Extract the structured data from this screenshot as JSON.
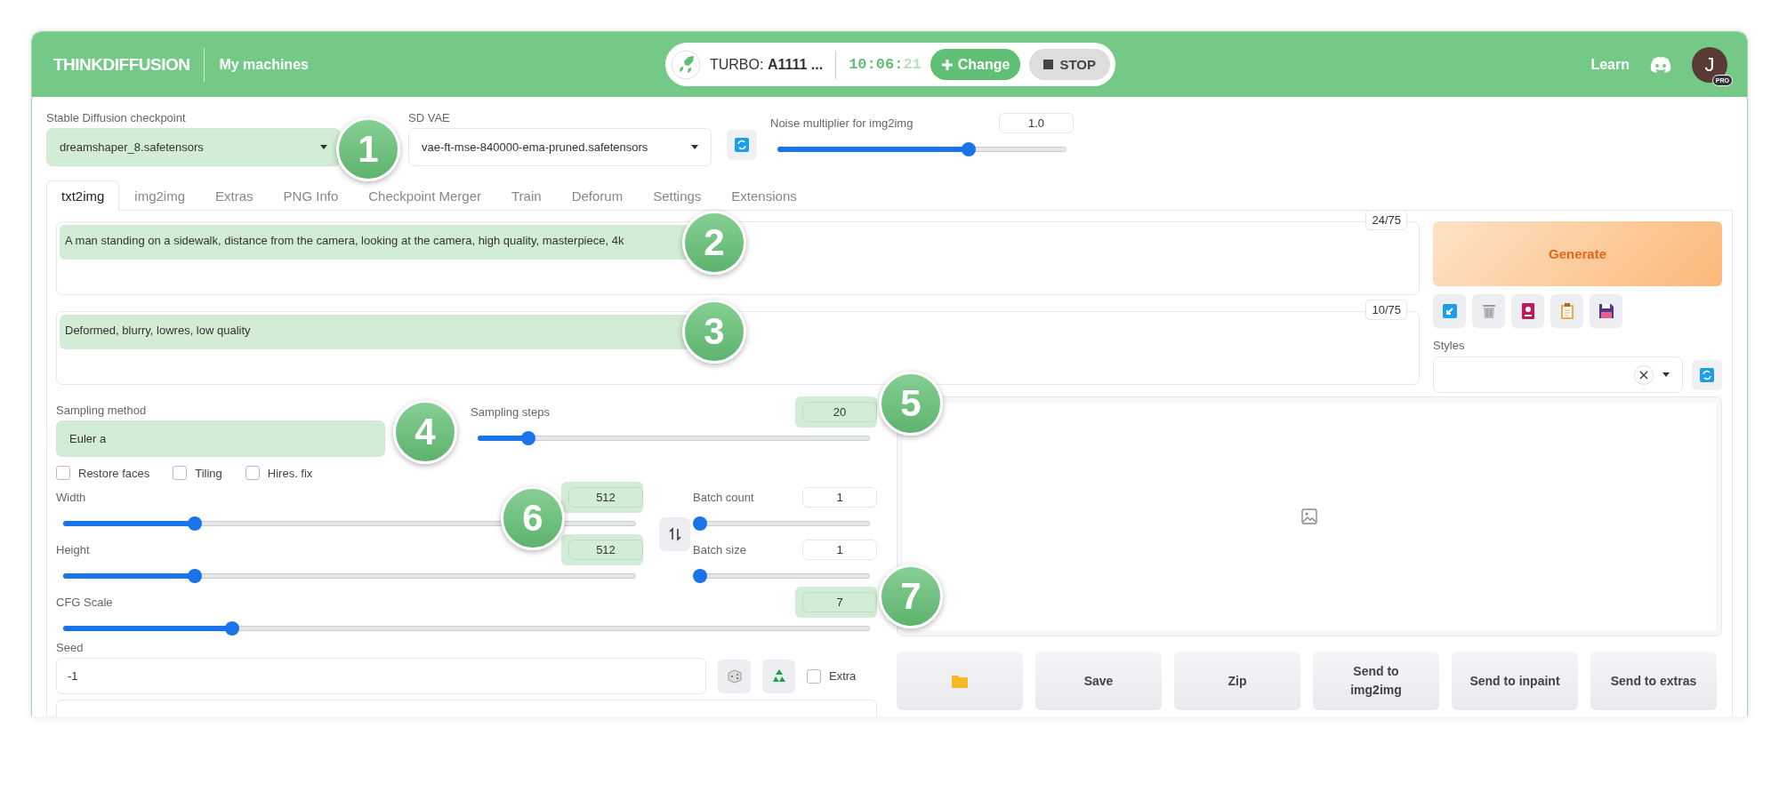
{
  "header": {
    "logo": "THINKDIFFUSION",
    "nav_link": "My machines",
    "machine_label": "TURBO:",
    "machine_name": "A1111 ...",
    "time_main": "10:06:",
    "time_seconds": "21",
    "change_button": "Change",
    "stop_button": "STOP",
    "learn_link": "Learn",
    "avatar_initial": "J",
    "avatar_badge": "PRO"
  },
  "checkpoint": {
    "label": "Stable Diffusion checkpoint",
    "value": "dreamshaper_8.safetensors",
    "highlighted": true
  },
  "vae": {
    "label": "SD VAE",
    "value": "vae-ft-mse-840000-ema-pruned.safetensors",
    "highlighted": false
  },
  "noise": {
    "label": "Noise multiplier for img2img",
    "value": "1.0",
    "level": 0.66,
    "highlighted": false
  },
  "tabs": [
    {
      "label": "txt2img",
      "selected": true
    },
    {
      "label": "img2img",
      "selected": false
    },
    {
      "label": "Extras",
      "selected": false
    },
    {
      "label": "PNG Info",
      "selected": false
    },
    {
      "label": "Checkpoint Merger",
      "selected": false
    },
    {
      "label": "Train",
      "selected": false
    },
    {
      "label": "Deforum",
      "selected": false
    },
    {
      "label": "Settings",
      "selected": false
    },
    {
      "label": "Extensions",
      "selected": false
    }
  ],
  "prompt": {
    "value": "A man standing on a sidewalk, distance from the camera, looking at the camera, high quality, masterpiece, 4k",
    "count": "24/75",
    "highlighted": true
  },
  "negative_prompt": {
    "value": "Deformed, blurry, lowres, low quality",
    "count": "10/75",
    "highlighted": true
  },
  "generate_button": "Generate",
  "styles": {
    "label": "Styles"
  },
  "sampling_method": {
    "label": "Sampling method",
    "value": "Euler a",
    "highlighted": true
  },
  "sampling_steps": {
    "label": "Sampling steps",
    "value": "20",
    "level": 0.13,
    "highlighted": true
  },
  "checkboxes": [
    {
      "label": "Restore faces",
      "checked": false
    },
    {
      "label": "Tiling",
      "checked": false
    },
    {
      "label": "Hires. fix",
      "checked": false
    }
  ],
  "width": {
    "label": "Width",
    "value": "512",
    "level": 0.23,
    "highlighted": true
  },
  "height": {
    "label": "Height",
    "value": "512",
    "level": 0.23,
    "highlighted": true
  },
  "batch_count": {
    "label": "Batch count",
    "value": "1",
    "level": 0.0,
    "highlighted": false
  },
  "batch_size": {
    "label": "Batch size",
    "value": "1",
    "level": 0.0,
    "highlighted": false
  },
  "cfg_scale": {
    "label": "CFG Scale",
    "value": "7",
    "level": 0.21,
    "highlighted": true
  },
  "seed": {
    "label": "Seed",
    "value": "-1"
  },
  "extra": {
    "label": "Extra",
    "checked": false
  },
  "output_buttons": [
    "Save",
    "Zip",
    "Send to img2img",
    "Send to inpaint",
    "Send to extras"
  ],
  "callouts": [
    {
      "label": "1"
    },
    {
      "label": "2"
    },
    {
      "label": "3"
    },
    {
      "label": "4"
    },
    {
      "label": "5"
    },
    {
      "label": "6"
    },
    {
      "label": "7"
    }
  ]
}
